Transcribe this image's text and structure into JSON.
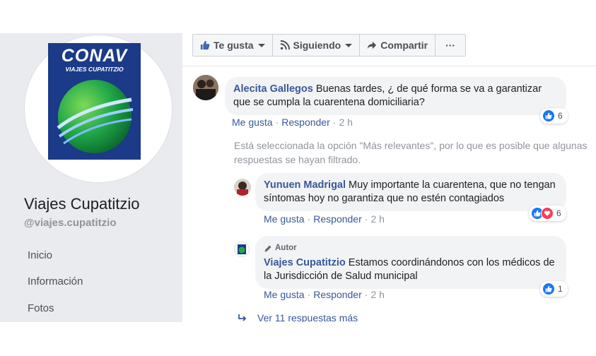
{
  "page": {
    "name": "Viajes Cupatitzio",
    "handle": "@viajes.cupatitzio",
    "logo_title": "CONAV",
    "logo_subtitle": "VIAJES CUPATITZIO",
    "nav": [
      "Inicio",
      "Información",
      "Fotos"
    ]
  },
  "action_bar": {
    "like_label": "Te gusta",
    "follow_label": "Siguiendo",
    "share_label": "Compartir",
    "more_label": "···"
  },
  "comments": [
    {
      "author": "Alecita Gallegos",
      "text": "Buenas tardes, ¿ de qué forma se va a garantizar que se cumpla la cuarentena domiciliaria?",
      "like_action": "Me gusta",
      "reply_action": "Responder",
      "time": "2 h",
      "reaction_count": "6"
    }
  ],
  "filter_note": "Está seleccionada la opción \"Más relevantes\", por lo que es posible que algunas respuestas se hayan filtrado.",
  "replies": [
    {
      "author": "Yunuen Madrigal",
      "text": "Muy importante la cuarentena, que no tengan síntomas hoy no garantiza que no estén contagiados",
      "like_action": "Me gusta",
      "reply_action": "Responder",
      "time": "2 h",
      "reaction_count": "6"
    },
    {
      "badge": "Autor",
      "author": "Viajes Cupatitzio",
      "text": "Estamos coordinándonos con los médicos de la Jurisdicción de Salud municipal",
      "like_action": "Me gusta",
      "reply_action": "Responder",
      "time": "2 h",
      "reaction_count": "1"
    }
  ],
  "more_replies": "Ver 11 respuestas más",
  "colors": {
    "link_blue": "#385898",
    "sidebar_bg": "#e9ebee",
    "bubble_bg": "#f2f3f5",
    "like_blue": "#1877f2",
    "love_red": "#f33e58"
  }
}
